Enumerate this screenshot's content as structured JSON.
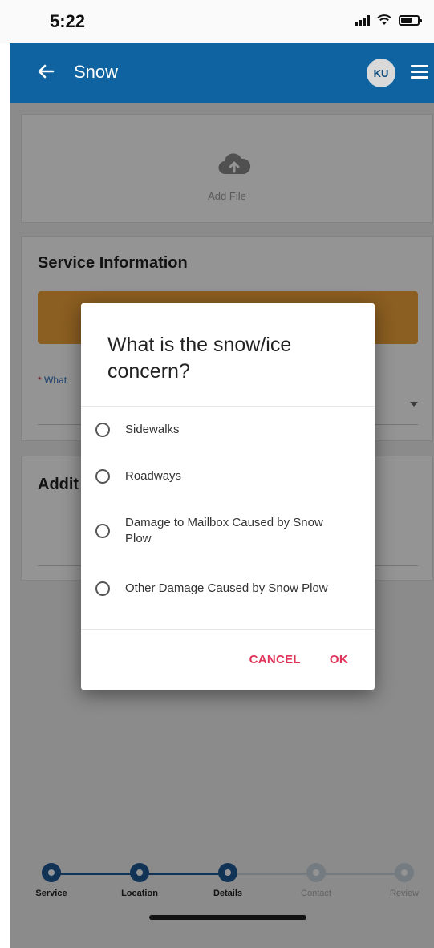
{
  "status_bar": {
    "time": "5:22",
    "icons": [
      "signal-icon",
      "wifi-icon",
      "battery-icon"
    ]
  },
  "app_bar": {
    "title": "Snow",
    "avatar_initials": "KU",
    "back_icon": "arrow-left-icon",
    "menu_icon": "hamburger-menu-icon",
    "color": "#0f63a0"
  },
  "upload": {
    "icon": "cloud-upload-icon",
    "label": "Add File"
  },
  "service_info": {
    "title": "Service Information",
    "warning_color": "#f0a33a",
    "required_marker": "*",
    "field_label_visible": "What"
  },
  "additional": {
    "title_visible": "Addit"
  },
  "dialog": {
    "title": "What is the snow/ice concern?",
    "options": [
      "Sidewalks",
      "Roadways",
      "Damage to Mailbox Caused by Snow Plow",
      "Other Damage Caused by Snow Plow"
    ],
    "cancel_label": "CANCEL",
    "ok_label": "OK",
    "accent": "#e0345a"
  },
  "stepper": {
    "steps": [
      {
        "label": "Service",
        "state": "done"
      },
      {
        "label": "Location",
        "state": "done"
      },
      {
        "label": "Details",
        "state": "current"
      },
      {
        "label": "Contact",
        "state": "todo"
      },
      {
        "label": "Review",
        "state": "todo"
      }
    ],
    "active_color": "#1e5a94",
    "inactive_color": "#c9d4de"
  }
}
